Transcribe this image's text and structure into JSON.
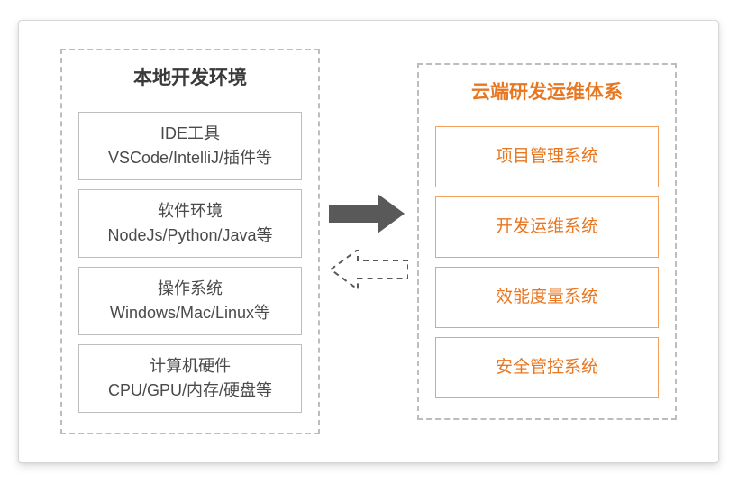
{
  "left": {
    "title": "本地开发环境",
    "boxes": [
      {
        "line1": "IDE工具",
        "line2": "VSCode/IntelliJ/插件等"
      },
      {
        "line1": "软件环境",
        "line2": "NodeJs/Python/Java等"
      },
      {
        "line1": "操作系统",
        "line2": "Windows/Mac/Linux等"
      },
      {
        "line1": "计算机硬件",
        "line2": "CPU/GPU/内存/硬盘等"
      }
    ]
  },
  "right": {
    "title": "云端研发运维体系",
    "boxes": [
      {
        "line1": "项目管理系统"
      },
      {
        "line1": "开发运维系统"
      },
      {
        "line1": "效能度量系统"
      },
      {
        "line1": "安全管控系统"
      }
    ]
  },
  "colors": {
    "accent": "#e87722",
    "border": "#bdbdbd",
    "arrow_solid": "#595959"
  }
}
